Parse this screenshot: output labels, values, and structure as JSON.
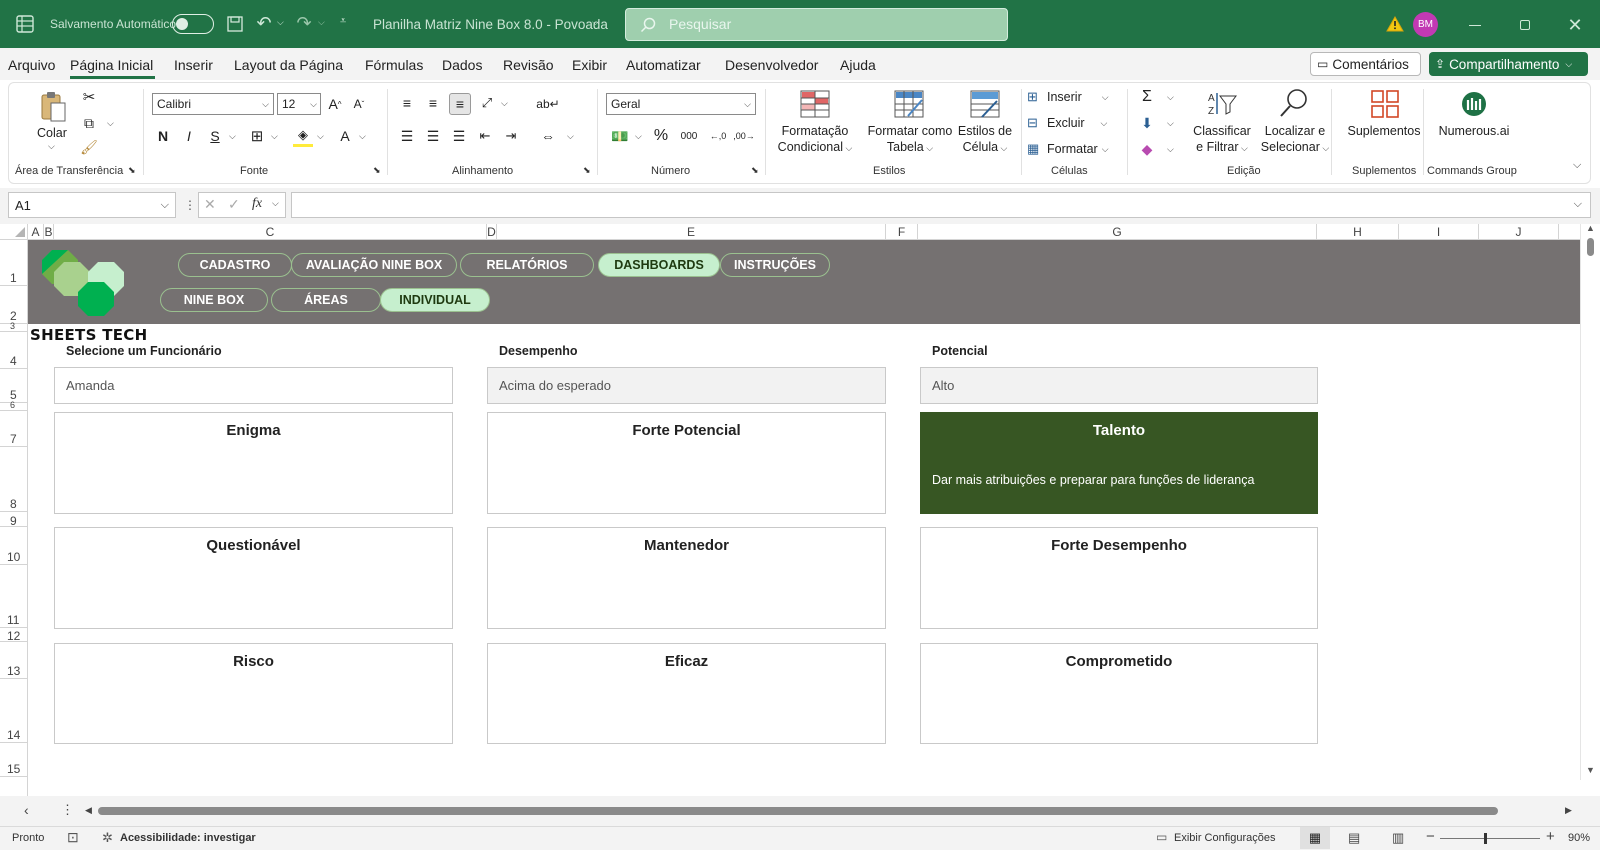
{
  "titlebar": {
    "autosave_label": "Salvamento Automático",
    "doc_title": "Planilha Matriz Nine Box 8.0 - Povoada",
    "search_placeholder": "Pesquisar",
    "avatar_initials": "BM",
    "avatar_color": "#c239b3"
  },
  "menu": {
    "items": [
      "Arquivo",
      "Página Inicial",
      "Inserir",
      "Layout da Página",
      "Fórmulas",
      "Dados",
      "Revisão",
      "Exibir",
      "Automatizar",
      "Desenvolvedor",
      "Ajuda"
    ],
    "active": "Página Inicial",
    "comments_label": "Comentários",
    "share_label": "Compartilhamento"
  },
  "ribbon": {
    "clipboard": {
      "paste_label": "Colar",
      "group_label": "Área de Transferência"
    },
    "font": {
      "name": "Calibri",
      "size": "12",
      "group_label": "Fonte",
      "bold": "N",
      "italic": "I",
      "underline": "S"
    },
    "alignment": {
      "group_label": "Alinhamento"
    },
    "number": {
      "format": "Geral",
      "group_label": "Número"
    },
    "styles": {
      "conditional_line1": "Formatação",
      "conditional_line2": "Condicional",
      "table_line1": "Formatar como",
      "table_line2": "Tabela",
      "cell_line1": "Estilos de",
      "cell_line2": "Célula",
      "group_label": "Estilos"
    },
    "cells": {
      "insert": "Inserir",
      "delete": "Excluir",
      "format": "Formatar",
      "group_label": "Células"
    },
    "editing": {
      "sort_line1": "Classificar",
      "sort_line2": "e Filtrar",
      "find_line1": "Localizar e",
      "find_line2": "Selecionar",
      "group_label": "Edição"
    },
    "addins": {
      "label": "Suplementos",
      "group_label": "Suplementos"
    },
    "commands": {
      "label": "Numerous.ai",
      "group_label": "Commands Group"
    }
  },
  "formula": {
    "name_box": "A1",
    "fx": "fx",
    "value": ""
  },
  "columns": [
    "A",
    "B",
    "C",
    "D",
    "E",
    "F",
    "G",
    "H",
    "I",
    "J"
  ],
  "rows": [
    "1",
    "2",
    "3",
    "4",
    "5",
    "6",
    "7",
    "8",
    "9",
    "10",
    "11",
    "12",
    "13",
    "14",
    "15"
  ],
  "dashboard": {
    "brand": "SHEETS TECH",
    "nav_top": [
      "CADASTRO",
      "AVALIAÇÃO NINE BOX",
      "RELATÓRIOS",
      "DASHBOARDS",
      "INSTRUÇÕES"
    ],
    "nav_bottom": [
      "NINE BOX",
      "ÁREAS",
      "INDIVIDUAL"
    ],
    "active_top": "DASHBOARDS",
    "active_bottom": "INDIVIDUAL",
    "selector": {
      "label": "Selecione um Funcionário",
      "value": "Amanda"
    },
    "performance": {
      "label": "Desempenho",
      "value": "Acima do esperado"
    },
    "potential": {
      "label": "Potencial",
      "value": "Alto"
    },
    "boxes": [
      {
        "title": "Enigma",
        "text": "",
        "highlight": false
      },
      {
        "title": "Forte Potencial",
        "text": "",
        "highlight": false
      },
      {
        "title": "Talento",
        "text": "Dar mais atribuições e preparar para funções de liderança",
        "highlight": true
      },
      {
        "title": "Questionável",
        "text": "",
        "highlight": false
      },
      {
        "title": "Mantenedor",
        "text": "",
        "highlight": false
      },
      {
        "title": "Forte Desempenho",
        "text": "",
        "highlight": false
      },
      {
        "title": "Risco",
        "text": "",
        "highlight": false
      },
      {
        "title": "Eficaz",
        "text": "",
        "highlight": false
      },
      {
        "title": "Comprometido",
        "text": "",
        "highlight": false
      }
    ],
    "header_bg": "#757171",
    "highlight_color": "#375623"
  },
  "status": {
    "ready": "Pronto",
    "accessibility": "Acessibilidade: investigar",
    "display_settings": "Exibir Configurações",
    "zoom": "90%"
  }
}
